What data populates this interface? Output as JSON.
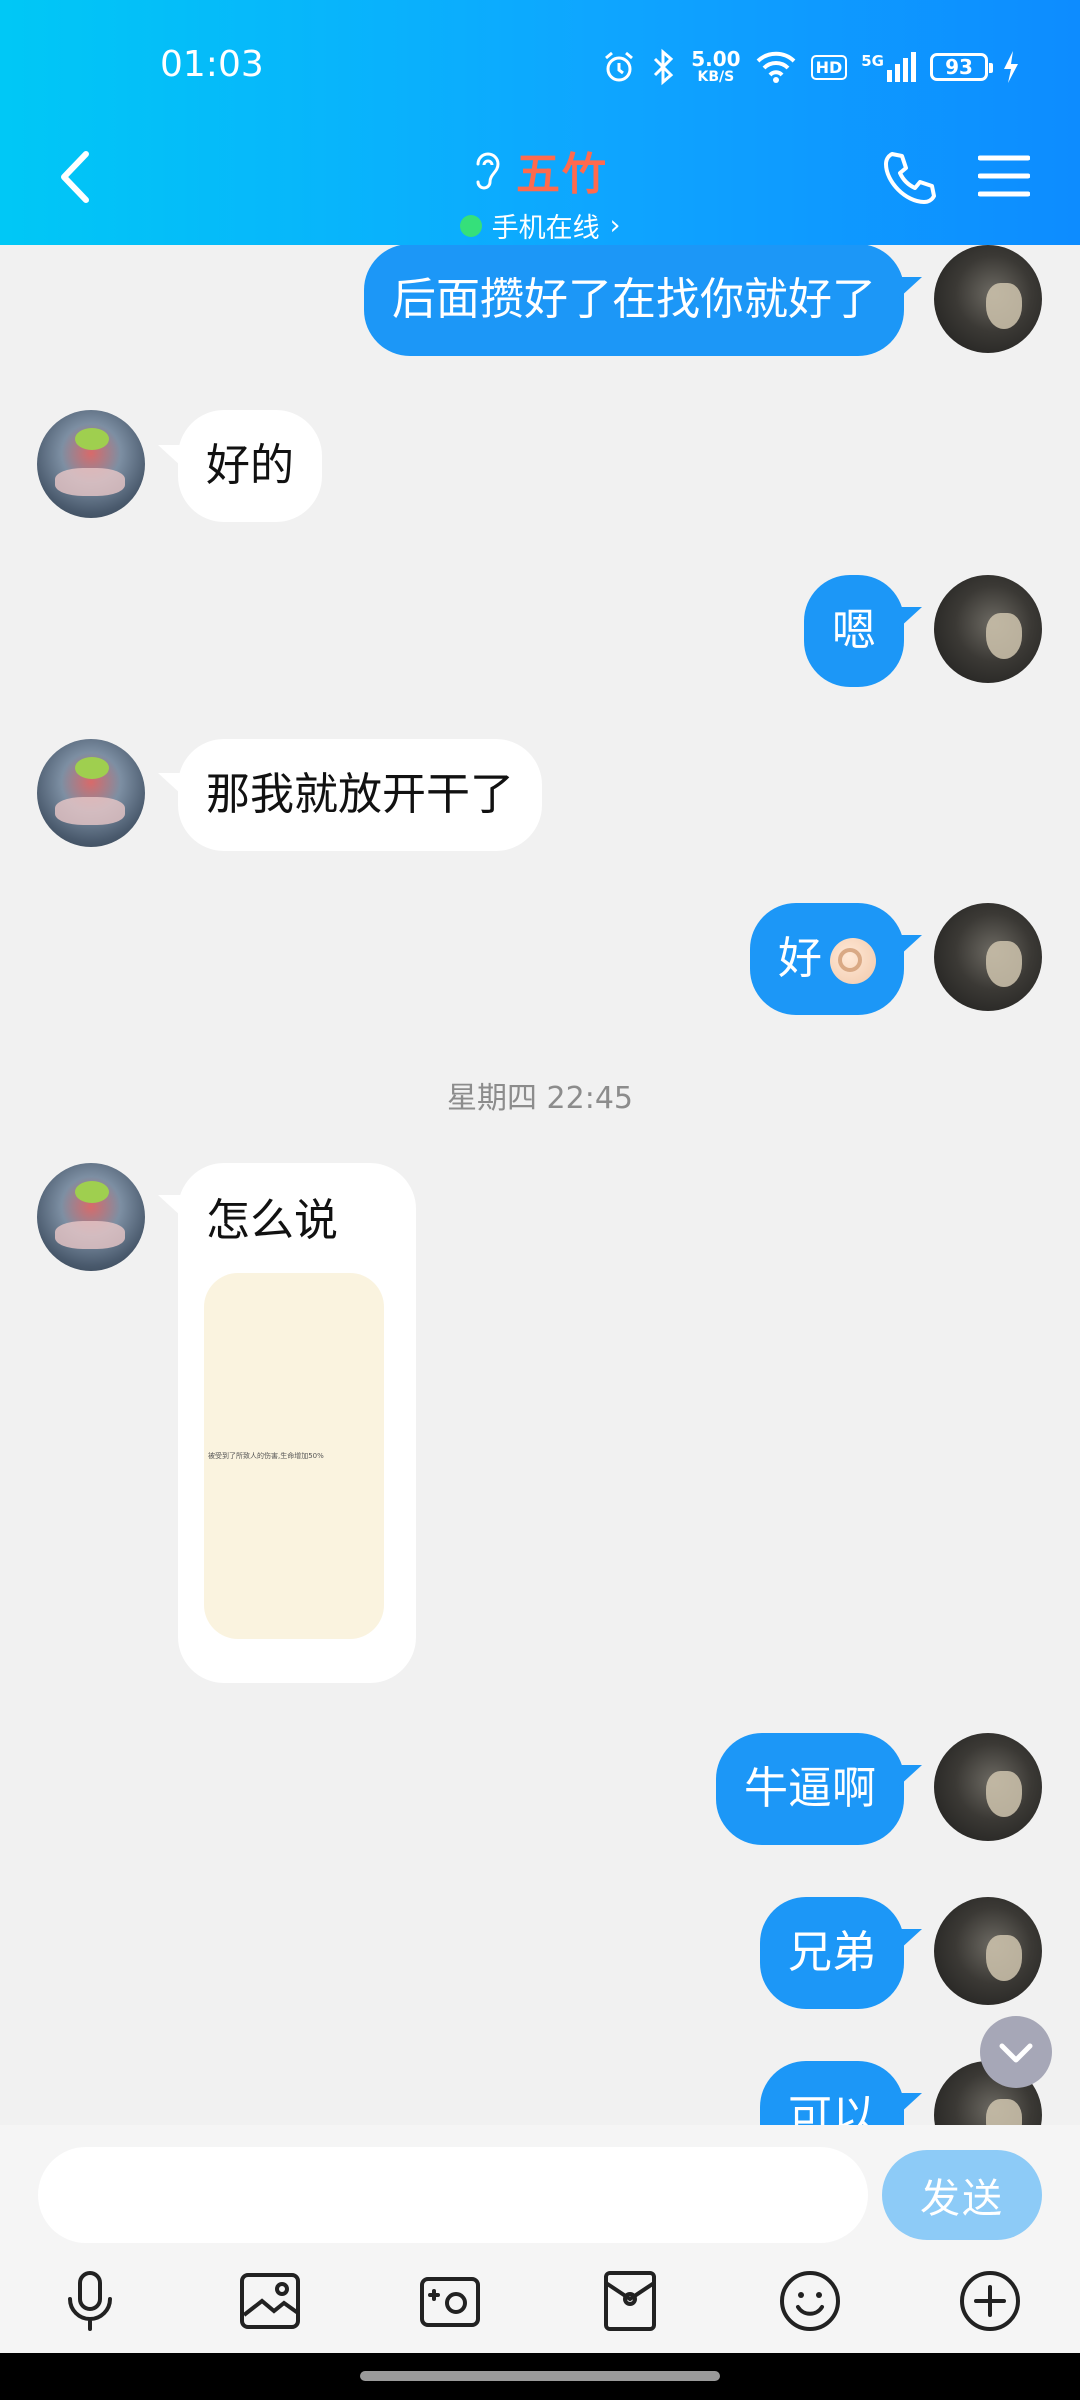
{
  "status_bar": {
    "time": "01:03",
    "net_speed_value": "5.00",
    "net_speed_unit": "KB/S",
    "hd_label": "HD",
    "signal_label": "5G",
    "battery": "93"
  },
  "header": {
    "contact_name": "五竹",
    "status": "手机在线",
    "chevron": "›",
    "name_color": "#ff6a4d"
  },
  "messages": [
    {
      "side": "out",
      "text": "后面攒好了在找你就好了"
    },
    {
      "side": "in",
      "text": "好的"
    },
    {
      "side": "out",
      "text": "嗯"
    },
    {
      "side": "in",
      "text": "那我就放开干了"
    },
    {
      "side": "out",
      "text": "好",
      "emoji": "ok-hand-emoji"
    },
    {
      "side": "in",
      "text": "怎么说",
      "image_caption": "被受到了所致人的伤害,生命增加50%"
    },
    {
      "side": "out",
      "text": "牛逼啊"
    },
    {
      "side": "out",
      "text": "兄弟"
    },
    {
      "side": "out",
      "text": "可以"
    }
  ],
  "timestamp": "星期四 22:45",
  "input": {
    "placeholder": "",
    "send_label": "发送"
  },
  "toolbar": [
    "mic-icon",
    "image-icon",
    "camera-icon",
    "red-packet-icon",
    "emoji-icon",
    "plus-icon"
  ],
  "colors": {
    "header_start": "#00c8f6",
    "header_end": "#0d8cff",
    "bubble_out": "#1c97f7",
    "bubble_in": "#ffffff",
    "send_button": "#8dcbf7"
  }
}
